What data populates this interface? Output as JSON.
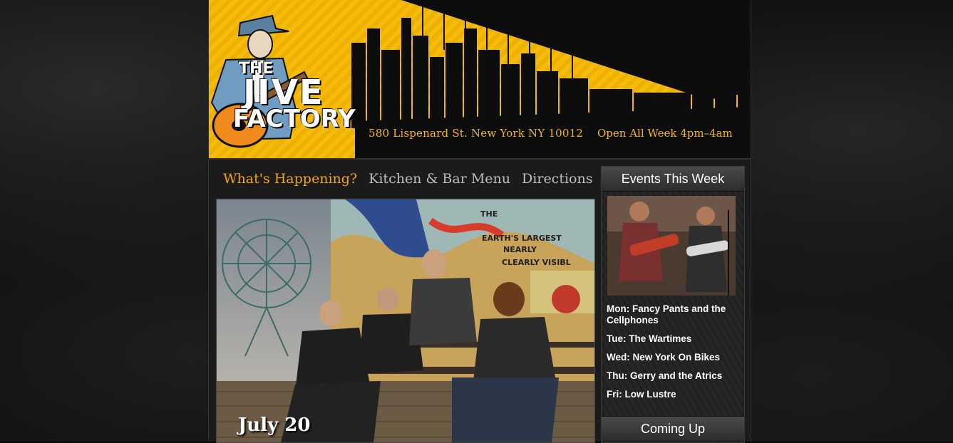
{
  "header": {
    "logo": {
      "line1": "THE",
      "line2": "JIVE",
      "line3": "FACTORY"
    },
    "address": "580 Lispenard St. New York NY 10012",
    "hours": "Open All Week 4pm–4am"
  },
  "nav": {
    "items": [
      {
        "label": "What's Happening?",
        "active": true
      },
      {
        "label": "Kitchen & Bar Menu",
        "active": false
      },
      {
        "label": "Directions",
        "active": false
      }
    ]
  },
  "feature": {
    "date": "July 20",
    "mural_text": [
      "THE",
      "EARTH'S LARGEST",
      "NEARLY",
      "CLEARLY VISIBL"
    ]
  },
  "sidebar": {
    "events_title": "Events This Week",
    "events": [
      "Mon: Fancy Pants and the Cellphones",
      "Tue: The Wartimes",
      "Wed: New York On Bikes",
      "Thu: Gerry and the Atrics",
      "Fri: Low Lustre"
    ],
    "coming_up_title": "Coming Up"
  },
  "colors": {
    "accent": "#f5b700",
    "nav_active": "#f5a400",
    "nav_inactive": "#bdbdbd"
  }
}
